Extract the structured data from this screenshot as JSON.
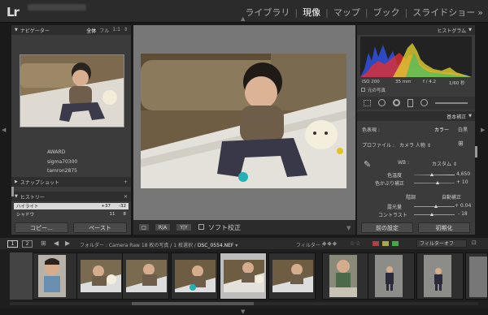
{
  "modules": {
    "library": "ライブラリ",
    "develop": "現像",
    "map": "マップ",
    "book": "ブック",
    "slideshow": "スライドショー",
    "more": "»"
  },
  "left_panel": {
    "navigator": {
      "title": "ナビゲーター",
      "zoom_options": [
        "全体",
        "フル",
        "1:1",
        "⇕"
      ]
    },
    "presets": [
      "AWARD",
      "sigma70300",
      "tamron2875"
    ],
    "snapshots": {
      "title": "スナップショット",
      "add": "+"
    },
    "history": {
      "title": "ヒストリー",
      "close": "✕",
      "rows": [
        {
          "label": "ハイライト",
          "v1": "+37",
          "v2": "-32"
        },
        {
          "label": "シャドウ",
          "v1": "11",
          "v2": "8"
        }
      ]
    },
    "copy_button": "コピー...",
    "paste_button": "ペースト"
  },
  "toolbar": {
    "view_label": "□",
    "compare_label": "R|A",
    "yy_label": "Y|Y",
    "soft_proof_label": "ソフト校正"
  },
  "right_panel": {
    "histogram": {
      "title": "ヒストグラム",
      "iso": "ISO 200",
      "focal": "35 mm",
      "aperture": "f / 4.2",
      "shutter": "1/60 秒",
      "original_photo": "元の写真"
    },
    "basic": {
      "title": "基本補正",
      "treatment_label": "色表現 :",
      "color": "カラー",
      "bw": "白黒",
      "profile_label": "プロファイル :",
      "profile_value": "カメラ 人物 ⇕",
      "wb_label": "WB :",
      "wb_value": "カスタム ⇕",
      "temp_label": "色温度",
      "temp_value": "4,650",
      "tint_label": "色かぶり補正",
      "tint_value": "+ 10",
      "tone_label": "階調",
      "auto_label": "自動補正",
      "exposure_label": "露光量",
      "exposure_value": "+ 0.04",
      "contrast_label": "コントラスト",
      "contrast_value": "- 18"
    },
    "previous_button": "前の設定",
    "reset_button": "初期化"
  },
  "filmstrip_header": {
    "page1": "1",
    "page2": "2",
    "folder_label": "フォルダー : Camera Raw",
    "count_text": "18 枚の写真 / 1 枚選択 /",
    "filename": "DSC_0554.NEF",
    "filter_label": "フィルター :",
    "filter_off": "フィルターオフ"
  },
  "colors": {
    "accent_up": "#e8e8e8",
    "histogram_red": "#e03030",
    "histogram_blue": "#3050e0",
    "histogram_yellow": "#e0d030"
  }
}
